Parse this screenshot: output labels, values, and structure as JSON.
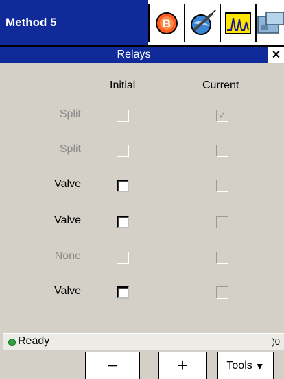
{
  "app": {
    "title": "Method 5"
  },
  "toolbar_icons": [
    "b-icon",
    "syringe-icon",
    "chromatogram-icon",
    "instrument-icon"
  ],
  "dialog": {
    "title": "Relays",
    "close_label": "×"
  },
  "columns": {
    "initial": "Initial",
    "current": "Current"
  },
  "rows": [
    {
      "label": "Split",
      "enabled": false,
      "initial_checked": false,
      "current_checked": true
    },
    {
      "label": "Split",
      "enabled": false,
      "initial_checked": false,
      "current_checked": false
    },
    {
      "label": "Valve",
      "enabled": true,
      "initial_checked": false,
      "current_checked": false
    },
    {
      "label": "Valve",
      "enabled": true,
      "initial_checked": false,
      "current_checked": false
    },
    {
      "label": "None",
      "enabled": false,
      "initial_checked": false,
      "current_checked": false
    },
    {
      "label": "Valve",
      "enabled": true,
      "initial_checked": false,
      "current_checked": false
    }
  ],
  "status": {
    "text": "Ready",
    "right_text": ")0",
    "dot_color": "#2ea043"
  },
  "buttons": {
    "minus": "−",
    "plus": "+",
    "tools": "Tools",
    "tools_arrow": "▼"
  },
  "colors": {
    "title_bg": "#102a9a",
    "panel_bg": "#d4d0c8"
  }
}
